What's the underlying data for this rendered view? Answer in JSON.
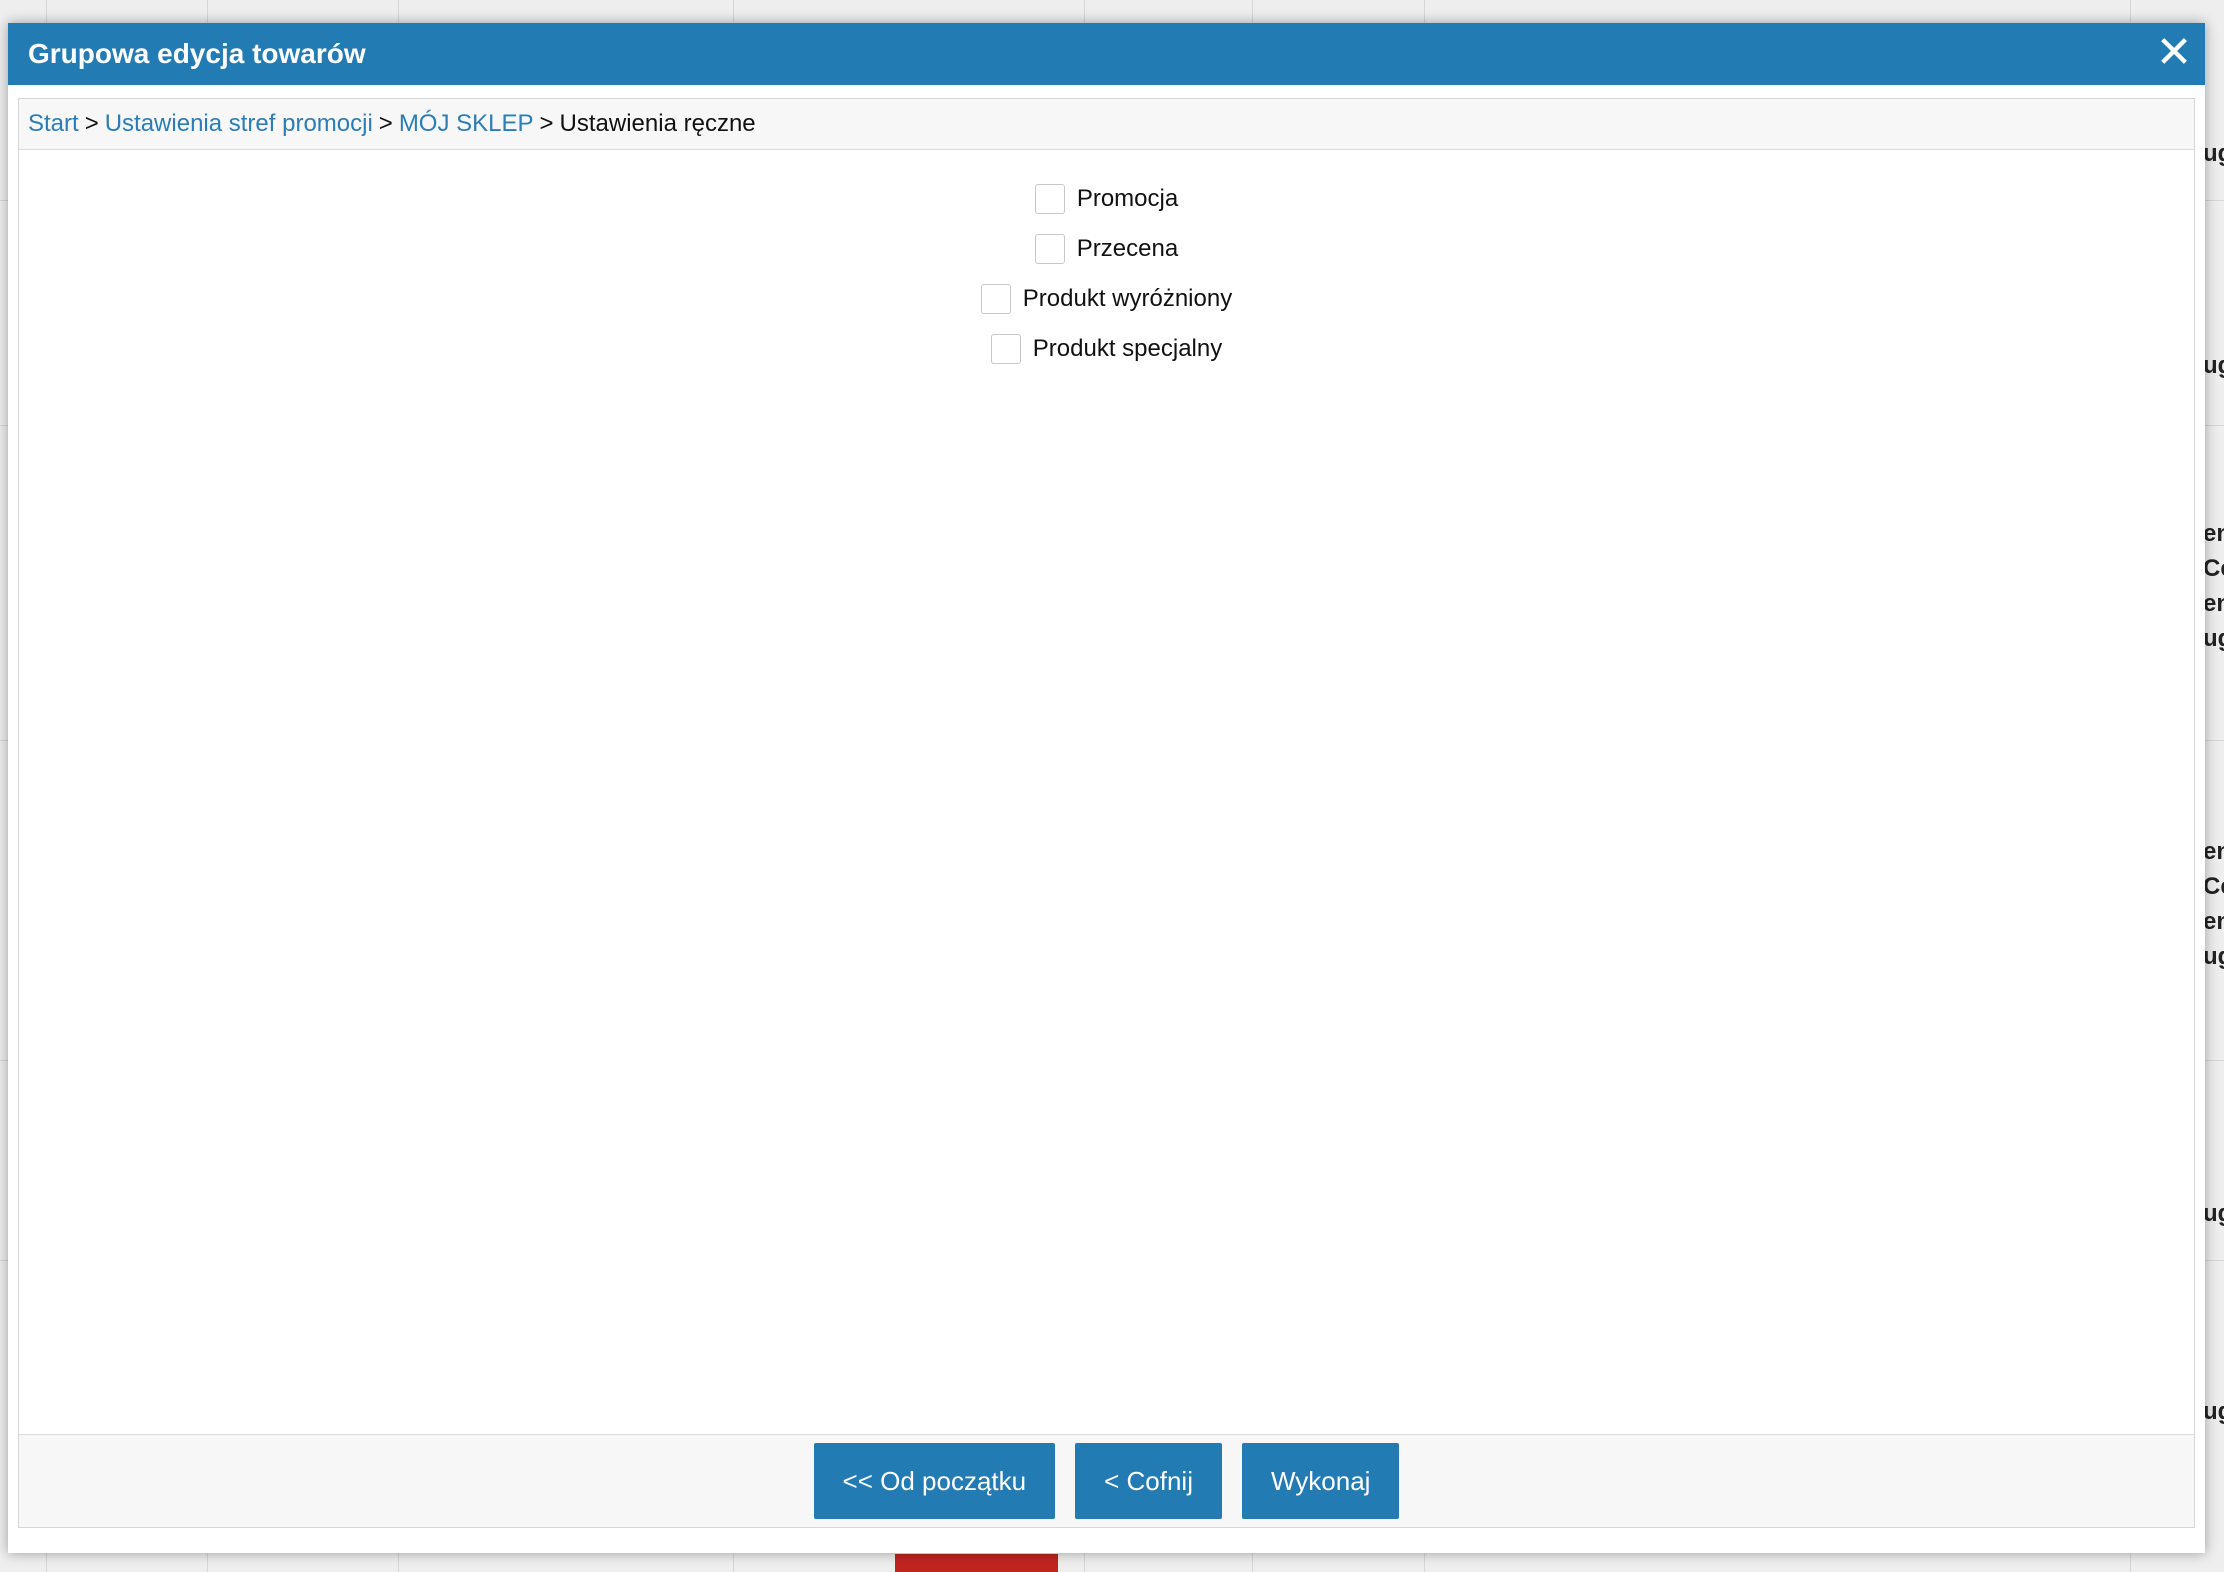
{
  "modal": {
    "title": "Grupowa edycja towarów",
    "close_icon": "close-icon"
  },
  "breadcrumb": {
    "items": [
      "Start",
      "Ustawienia stref promocji",
      "MÓJ SKLEP"
    ],
    "current": "Ustawienia ręczne",
    "separator": ">"
  },
  "options": [
    {
      "label": "Promocja",
      "checked": false
    },
    {
      "label": "Przecena",
      "checked": false
    },
    {
      "label": "Produkt wyróżniony",
      "checked": false
    },
    {
      "label": "Produkt specjalny",
      "checked": false
    }
  ],
  "footer": {
    "restart_label": "<< Od początku",
    "back_label": "< Cofnij",
    "execute_label": "Wykonaj"
  },
  "background": {
    "peek_text": [
      "ug",
      "ug",
      "en",
      "Ce",
      "en",
      "ug",
      "en",
      "Ce",
      "en",
      "ug",
      "ug",
      "ug"
    ]
  },
  "colors": {
    "accent": "#237bb3",
    "link": "#2a7db6"
  }
}
